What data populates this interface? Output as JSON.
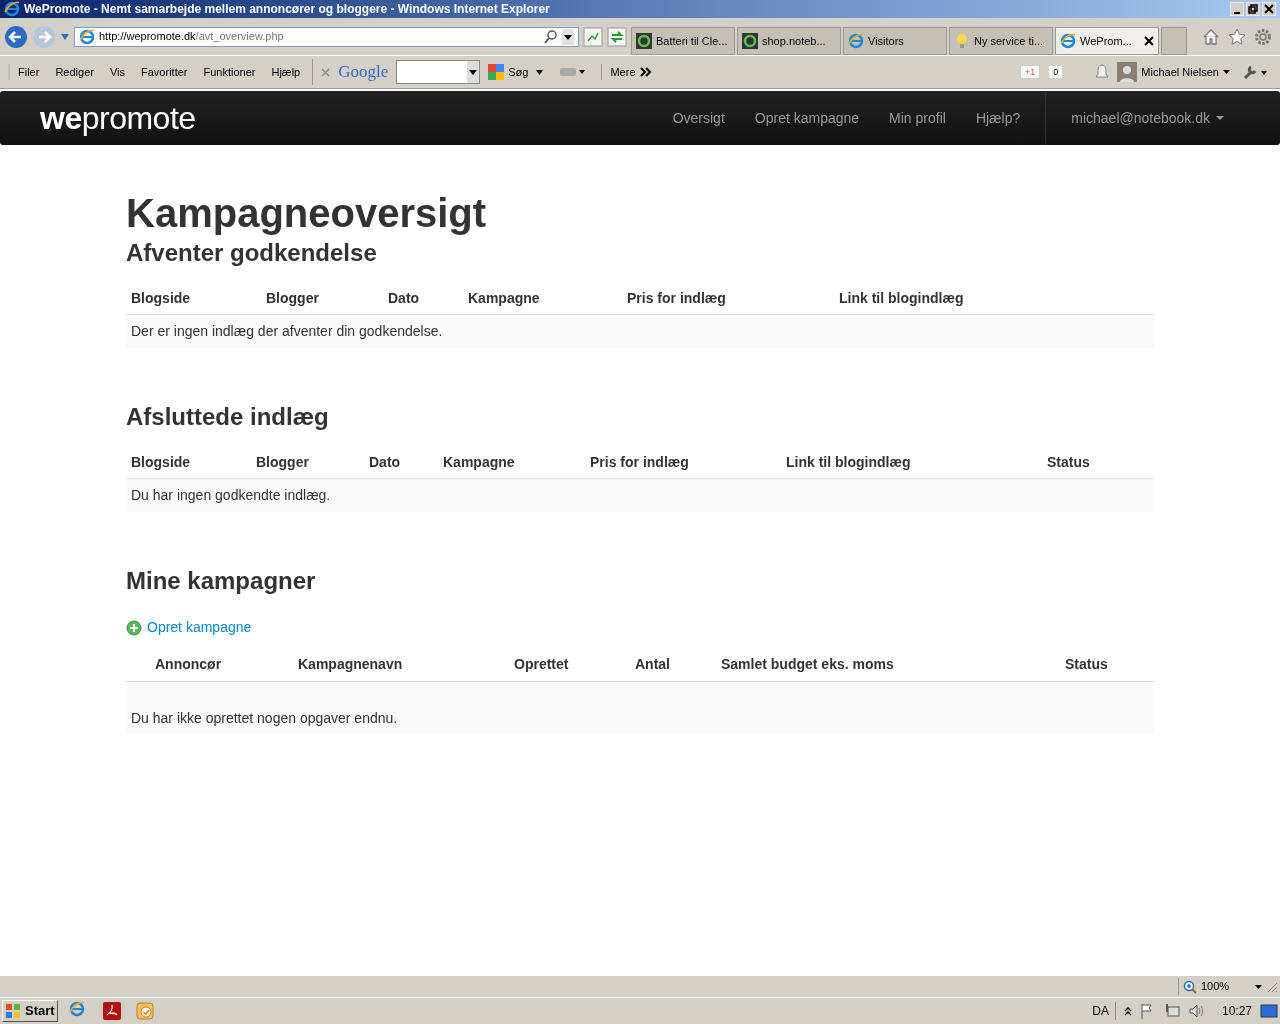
{
  "window": {
    "title": "WePromote - Nemt samarbejde mellem annoncører og bloggere - Windows Internet Explorer"
  },
  "address": {
    "host": "http://wepromote.dk",
    "path": "/avt_overview.php"
  },
  "tabs": [
    {
      "label": "Batteri til Cle...",
      "selected": false,
      "kind": "site"
    },
    {
      "label": "shop.noteb...",
      "selected": false,
      "kind": "site"
    },
    {
      "label": "Visitors",
      "selected": false,
      "kind": "ie"
    },
    {
      "label": "Ny service ti...",
      "selected": false,
      "kind": "bulb"
    },
    {
      "label": "WeProm...",
      "selected": true,
      "kind": "ie"
    }
  ],
  "menu": [
    "Filer",
    "Rediger",
    "Vis",
    "Favoritter",
    "Funktioner",
    "Hjælp"
  ],
  "toolbar": {
    "google_logo": "Google",
    "search_button": "Søg",
    "more": "Mere",
    "plus_one": "+1",
    "plus_count": "0",
    "user": "Michael Nielsen"
  },
  "site": {
    "logo": "**we**promote",
    "nav": [
      {
        "label": "Oversigt"
      },
      {
        "label": "Opret kampagne"
      },
      {
        "label": "Min profil"
      },
      {
        "label": "Hjælp?"
      }
    ],
    "account": "michael@notebook.dk"
  },
  "page": {
    "heading": "Kampagneoversigt",
    "sections": [
      {
        "title": "Afventer godkendelse",
        "columns": [
          "Blogside",
          "Blogger",
          "Dato",
          "Kampagne",
          "Pris for indlæg",
          "Link til blogindlæg"
        ],
        "empty_text": "Der er ingen indlæg der afventer din godkendelse."
      },
      {
        "title": "Afsluttede indlæg",
        "columns": [
          "Blogside",
          "Blogger",
          "Dato",
          "Kampagne",
          "Pris for indlæg",
          "Link til blogindlæg",
          "Status"
        ],
        "empty_text": "Du har ingen godkendte indlæg."
      },
      {
        "title": "Mine kampagner",
        "action": "Opret kampagne",
        "columns": [
          "Annoncør",
          "Kampagnenavn",
          "Oprettet",
          "Antal",
          "Samlet budget eks. moms",
          "Status"
        ],
        "empty_text": "Du har ikke oprettet nogen opgaver endnu."
      }
    ]
  },
  "status_bar": {
    "zoom": "100%"
  },
  "taskbar": {
    "start": "Start",
    "language": "DA",
    "clock": "10:27"
  }
}
